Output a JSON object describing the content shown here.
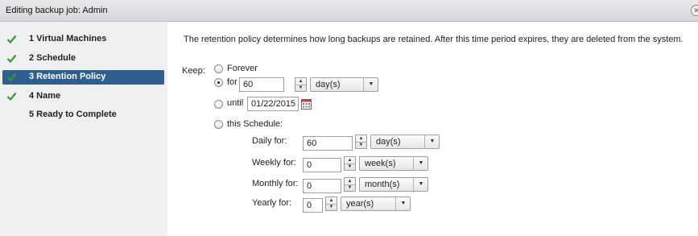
{
  "window": {
    "title": "Editing backup job: Admin",
    "close_icon": "close-icon"
  },
  "sidebar": {
    "steps": [
      {
        "number": "1",
        "label": "1 Virtual Machines",
        "completed": true,
        "active": false
      },
      {
        "number": "2",
        "label": "2 Schedule",
        "completed": true,
        "active": false
      },
      {
        "number": "3",
        "label": "3 Retention Policy",
        "completed": true,
        "active": true
      },
      {
        "number": "4",
        "label": "4 Name",
        "completed": true,
        "active": false
      },
      {
        "number": "5",
        "label": "5 Ready to Complete",
        "completed": false,
        "active": false
      }
    ]
  },
  "main": {
    "intro": "The retention policy determines how long backups are retained.  After this time period expires, they are deleted from the system.",
    "keep_label": "Keep:",
    "options": {
      "forever": {
        "label": "Forever",
        "selected": false
      },
      "for": {
        "label": "for",
        "selected": true,
        "value": "60",
        "unit": "day(s)"
      },
      "until": {
        "label": "until",
        "selected": false,
        "date": "01/22/2015"
      },
      "schedule": {
        "label": "this Schedule:",
        "selected": false
      }
    },
    "schedule_rows": {
      "daily": {
        "label": "Daily for:",
        "value": "60",
        "unit": "day(s)"
      },
      "weekly": {
        "label": "Weekly for:",
        "value": "0",
        "unit": "week(s)"
      },
      "monthly": {
        "label": "Monthly for:",
        "value": "0",
        "unit": "month(s)"
      },
      "yearly": {
        "label": "Yearly for:",
        "value": "0",
        "unit": "year(s)"
      }
    }
  },
  "colors": {
    "accent": "#2f5f8f",
    "check": "#3a9a2f",
    "sidebar_bg": "#eef0f2"
  }
}
